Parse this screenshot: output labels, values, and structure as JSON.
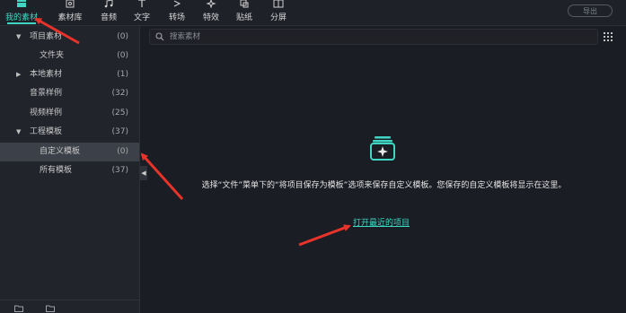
{
  "toolbar": {
    "tabs": [
      {
        "label": "我的素材",
        "icon": "folder-stack-icon",
        "active": true
      },
      {
        "label": "素材库",
        "icon": "library-icon"
      },
      {
        "label": "音频",
        "icon": "music-note-icon"
      },
      {
        "label": "文字",
        "icon": "text-icon"
      },
      {
        "label": "转场",
        "icon": "transition-icon"
      },
      {
        "label": "特效",
        "icon": "effects-icon"
      },
      {
        "label": "贴纸",
        "icon": "sticker-icon"
      },
      {
        "label": "分屏",
        "icon": "split-screen-icon"
      }
    ],
    "export_label": "导出"
  },
  "sidebar": {
    "items": [
      {
        "label": "项目素材",
        "count": "(0)",
        "expanded": true
      },
      {
        "label": "文件夹",
        "count": "(0)"
      },
      {
        "label": "本地素材",
        "count": "(1)",
        "expanded": false
      },
      {
        "label": "音景样例",
        "count": "(32)"
      },
      {
        "label": "视频样例",
        "count": "(25)"
      },
      {
        "label": "工程模板",
        "count": "(37)",
        "expanded": true
      },
      {
        "label": "自定义模板",
        "count": "(0)",
        "selected": true
      },
      {
        "label": "所有模板",
        "count": "(37)"
      }
    ]
  },
  "search": {
    "placeholder": "搜索素材",
    "value": ""
  },
  "main": {
    "empty_message": "选择“文件”菜单下的“将项目保存为模板”选项来保存自定义模板。您保存的自定义模板将显示在这里。",
    "open_recent_label": "打开最近的项目"
  },
  "colors": {
    "accent": "#3fd6c3",
    "background": "#1b1d24",
    "sidebar": "#22242c",
    "selected_row": "#3c4049",
    "annotation": "#e8332a"
  }
}
